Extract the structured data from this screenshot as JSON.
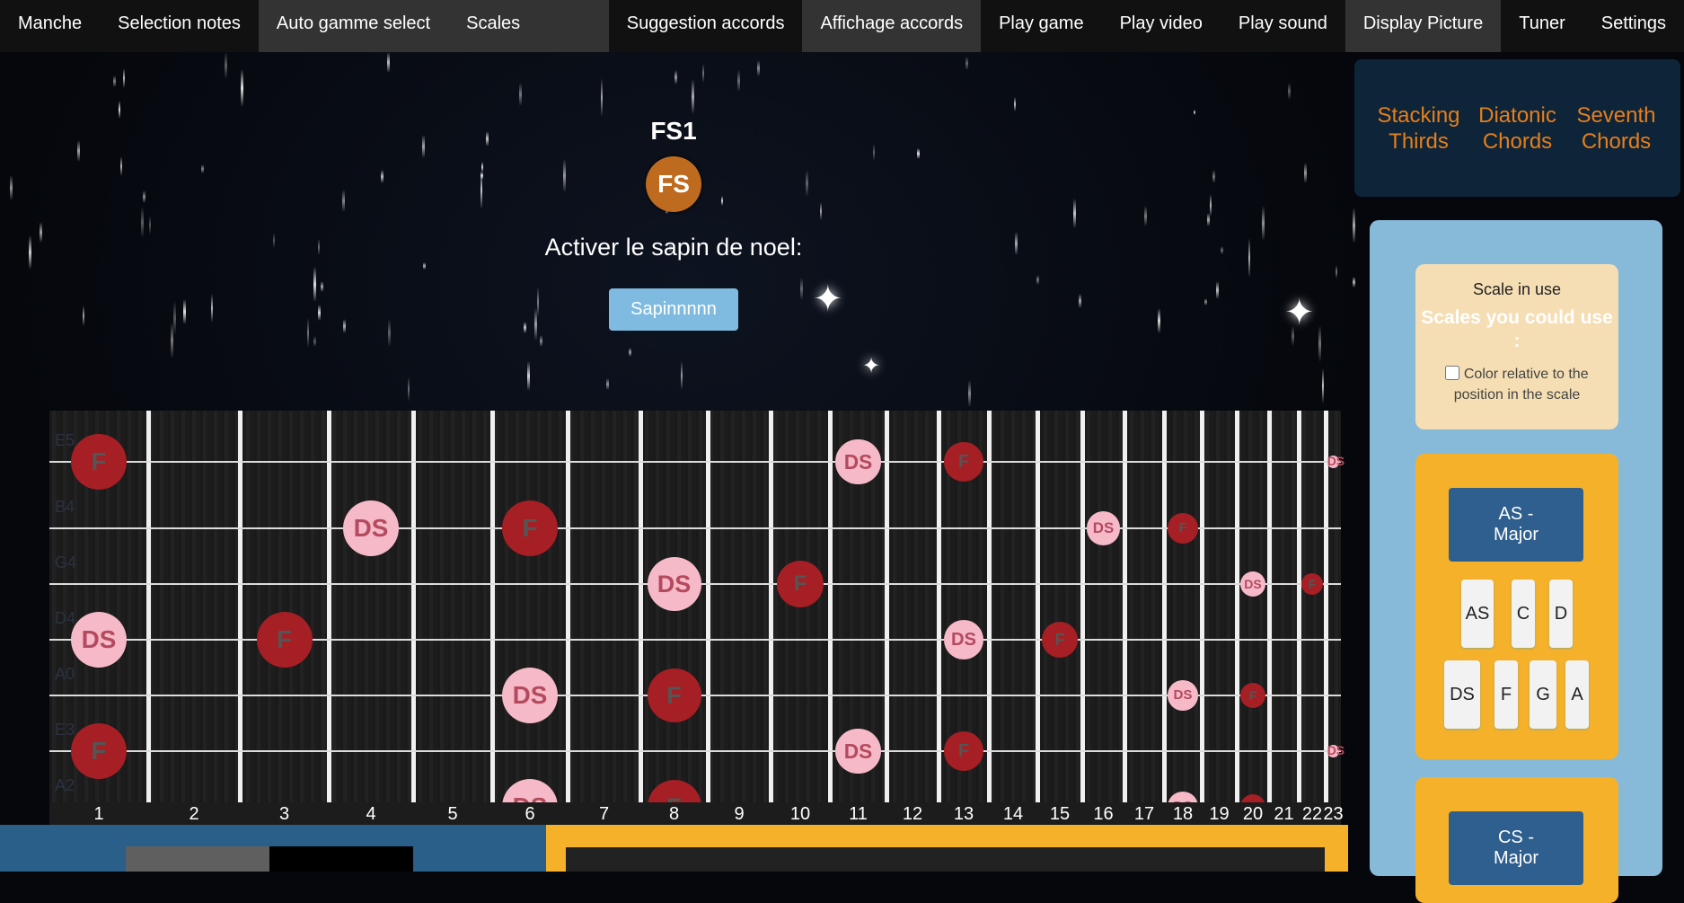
{
  "nav": [
    "Manche",
    "Selection notes",
    "Auto gamme select",
    "Scales",
    "Suggestion accords",
    "Affichage accords",
    "Play game",
    "Play video",
    "Play sound",
    "Display Picture",
    "Tuner",
    "Settings"
  ],
  "center": {
    "title": "FS1",
    "badge": "FS",
    "sapin_label": "Activer le sapin de noel:",
    "sapin_button": "Sapinnnnn"
  },
  "fretboard": {
    "string_labels": [
      "E5",
      "B4",
      "G4",
      "D4",
      "A0",
      "E3",
      "A2"
    ],
    "fret_numbers": [
      "1",
      "2",
      "3",
      "4",
      "5",
      "6",
      "7",
      "8",
      "9",
      "10",
      "11",
      "12",
      "13",
      "14",
      "15",
      "16",
      "17",
      "18",
      "19",
      "20",
      "21",
      "22",
      "23"
    ],
    "notes": [
      {
        "s": 0,
        "f": 1,
        "n": "F"
      },
      {
        "s": 0,
        "f": 11,
        "n": "DS"
      },
      {
        "s": 0,
        "f": 13,
        "n": "F"
      },
      {
        "s": 0,
        "f": 23,
        "n": "DS"
      },
      {
        "s": 1,
        "f": 4,
        "n": "DS"
      },
      {
        "s": 1,
        "f": 6,
        "n": "F"
      },
      {
        "s": 1,
        "f": 16,
        "n": "DS"
      },
      {
        "s": 1,
        "f": 18,
        "n": "F"
      },
      {
        "s": 2,
        "f": 8,
        "n": "DS"
      },
      {
        "s": 2,
        "f": 10,
        "n": "F"
      },
      {
        "s": 2,
        "f": 20,
        "n": "DS"
      },
      {
        "s": 2,
        "f": 22,
        "n": "F"
      },
      {
        "s": 3,
        "f": 1,
        "n": "DS"
      },
      {
        "s": 3,
        "f": 3,
        "n": "F"
      },
      {
        "s": 3,
        "f": 13,
        "n": "DS"
      },
      {
        "s": 3,
        "f": 15,
        "n": "F"
      },
      {
        "s": 4,
        "f": 6,
        "n": "DS"
      },
      {
        "s": 4,
        "f": 8,
        "n": "F"
      },
      {
        "s": 4,
        "f": 18,
        "n": "DS"
      },
      {
        "s": 4,
        "f": 20,
        "n": "F"
      },
      {
        "s": 5,
        "f": 1,
        "n": "F"
      },
      {
        "s": 5,
        "f": 11,
        "n": "DS"
      },
      {
        "s": 5,
        "f": 13,
        "n": "F"
      },
      {
        "s": 5,
        "f": 23,
        "n": "DS"
      },
      {
        "s": 6,
        "f": 6,
        "n": "DS"
      },
      {
        "s": 6,
        "f": 8,
        "n": "F"
      },
      {
        "s": 6,
        "f": 18,
        "n": "DS"
      },
      {
        "s": 6,
        "f": 20,
        "n": "F"
      }
    ]
  },
  "chord_nav": [
    [
      "Stacking",
      "Thirds"
    ],
    [
      "Diatonic",
      "Chords"
    ],
    [
      "Seventh",
      "Chords"
    ]
  ],
  "side": {
    "scale_in_use": "Scale in use",
    "scales_could": "Scales you could use :",
    "color_relative": "Color relative to the position in the scale"
  },
  "scale_cards": [
    {
      "name": [
        "AS -",
        "Major"
      ],
      "notes": [
        "AS",
        "C",
        "D",
        "DS",
        "F",
        "G",
        "A"
      ]
    },
    {
      "name": [
        "CS -",
        "Major"
      ],
      "notes": []
    }
  ]
}
